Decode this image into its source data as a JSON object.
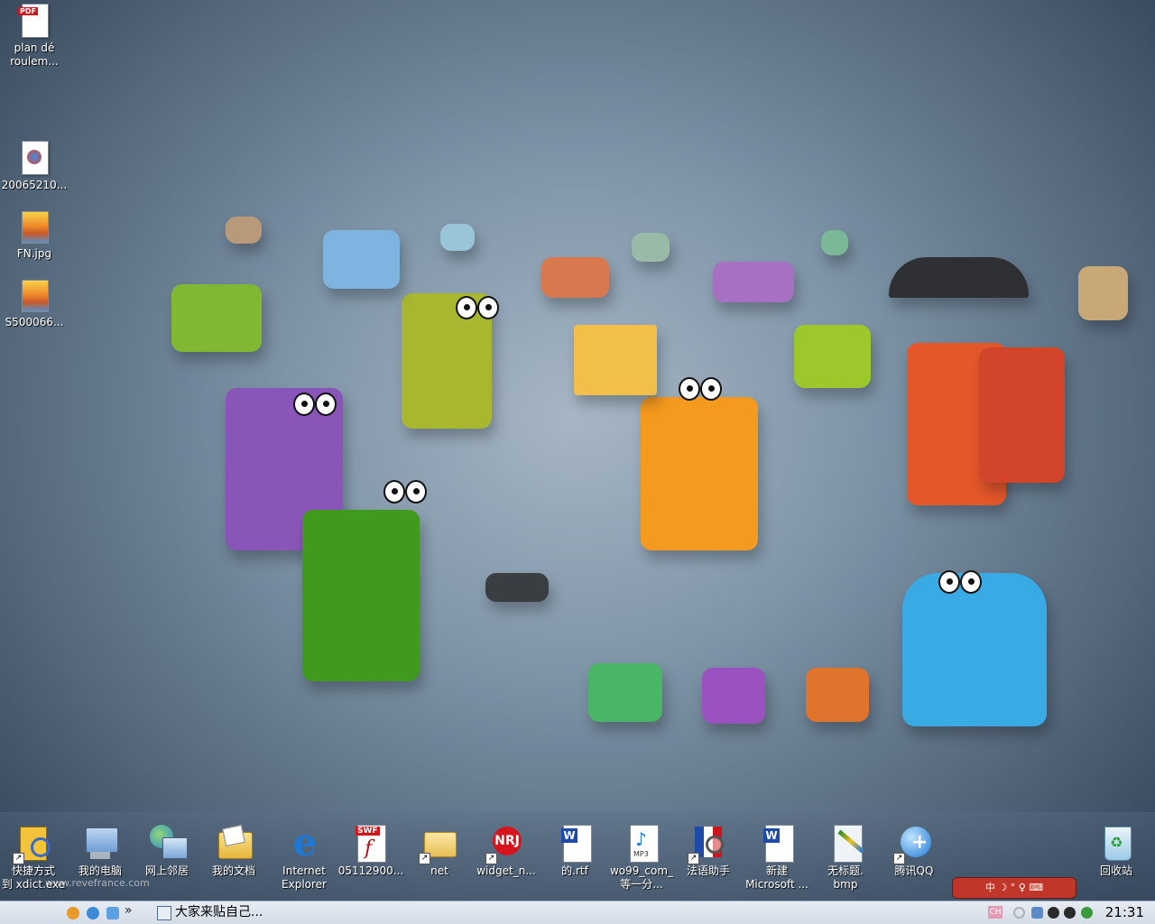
{
  "desktop_icons": [
    {
      "label_line1": "plan  dé",
      "label_line2": "roulem...",
      "icon": "pdf-icon"
    },
    {
      "label_line1": "20065210...",
      "icon": "image-file-icon"
    },
    {
      "label_line1": "FN.jpg",
      "icon": "jpg-icon"
    },
    {
      "label_line1": "S500066...",
      "icon": "jpg-icon"
    }
  ],
  "quick_launch": [
    {
      "label_line1": "快捷方式",
      "label_line2": "到 xdict.exe",
      "icon": "dictionary-icon"
    },
    {
      "label_line1": "我的电脑",
      "icon": "my-computer-icon"
    },
    {
      "label_line1": "网上邻居",
      "icon": "network-icon"
    },
    {
      "label_line1": "我的文档",
      "icon": "my-documents-icon"
    },
    {
      "label_line1": "Internet",
      "label_line2": "Explorer",
      "icon": "internet-explorer-icon"
    },
    {
      "label_line1": "05112900...",
      "icon": "swf-icon"
    },
    {
      "label_line1": "net",
      "icon": "folder-icon"
    },
    {
      "label_line1": "widget_n...",
      "icon": "widget-icon"
    },
    {
      "label_line1": "的.rtf",
      "icon": "word-doc-icon"
    },
    {
      "label_line1": "wo99_com_",
      "label_line2": "等一分...",
      "icon": "mp3-icon"
    },
    {
      "label_line1": "法语助手",
      "icon": "french-helper-icon"
    },
    {
      "label_line1": "新建",
      "label_line2": "Microsoft ...",
      "icon": "word-doc-icon"
    },
    {
      "label_line1": "无标题.",
      "label_line2": "bmp",
      "icon": "paint-icon"
    },
    {
      "label_line1": "腾讯QQ",
      "icon": "qq-icon"
    },
    {
      "label_line1": "回收站",
      "icon": "recycle-bin-icon"
    }
  ],
  "qq_bar": {
    "text": "中 ☽ ° ♀ ⌨"
  },
  "watermark": {
    "text": "www.revefrance.com"
  },
  "taskbar": {
    "window_title": "大家来贴自己...",
    "chevron": "»",
    "lang": "CH",
    "clock": "21:31"
  }
}
